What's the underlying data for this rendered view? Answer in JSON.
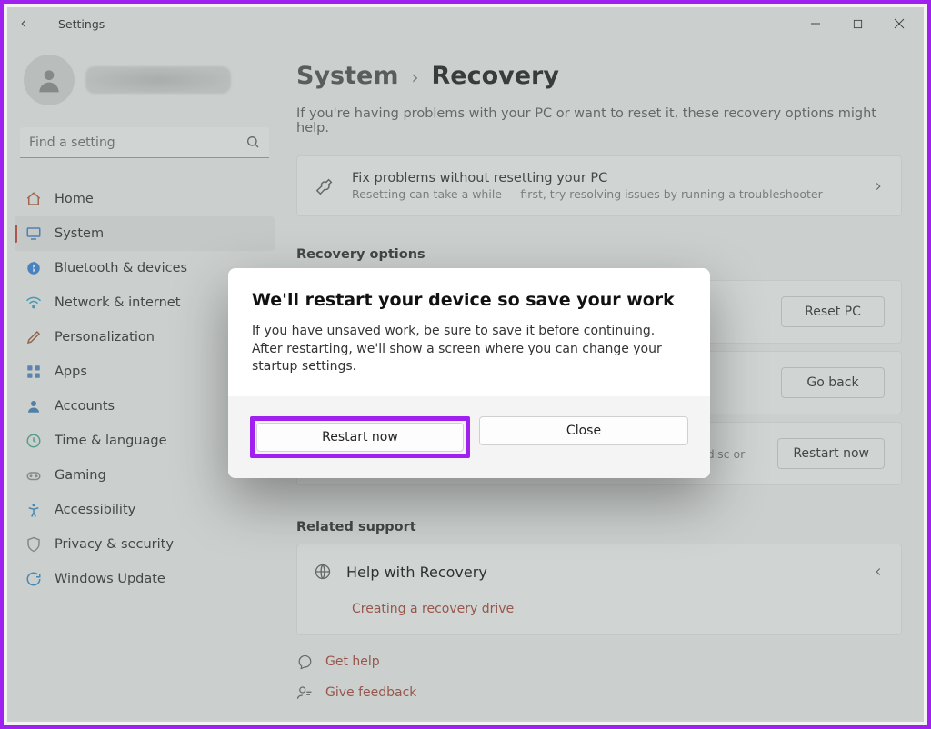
{
  "window": {
    "title": "Settings"
  },
  "search": {
    "placeholder": "Find a setting"
  },
  "nav": {
    "items": [
      {
        "label": "Home"
      },
      {
        "label": "System"
      },
      {
        "label": "Bluetooth & devices"
      },
      {
        "label": "Network & internet"
      },
      {
        "label": "Personalization"
      },
      {
        "label": "Apps"
      },
      {
        "label": "Accounts"
      },
      {
        "label": "Time & language"
      },
      {
        "label": "Gaming"
      },
      {
        "label": "Accessibility"
      },
      {
        "label": "Privacy & security"
      },
      {
        "label": "Windows Update"
      }
    ]
  },
  "breadcrumb": {
    "parent": "System",
    "current": "Recovery"
  },
  "page": {
    "subtitle": "If you're having problems with your PC or want to reset it, these recovery options might help.",
    "fix": {
      "title": "Fix problems without resetting your PC",
      "subtitle": "Resetting can take a while — first, try resolving issues by running a troubleshooter"
    },
    "recovery_heading": "Recovery options",
    "options": {
      "reset_btn": "Reset PC",
      "goback_btn": "Go back",
      "restart_hint": "disc or",
      "restart_btn": "Restart now"
    },
    "related_heading": "Related support",
    "help": {
      "title": "Help with Recovery",
      "link": "Creating a recovery drive"
    },
    "footer": {
      "gethelp": "Get help",
      "feedback": "Give feedback"
    }
  },
  "dialog": {
    "title": "We'll restart your device so save your work",
    "body": "If you have unsaved work, be sure to save it before continuing. After restarting, we'll show a screen where you can change your startup settings.",
    "restart": "Restart now",
    "close": "Close"
  }
}
